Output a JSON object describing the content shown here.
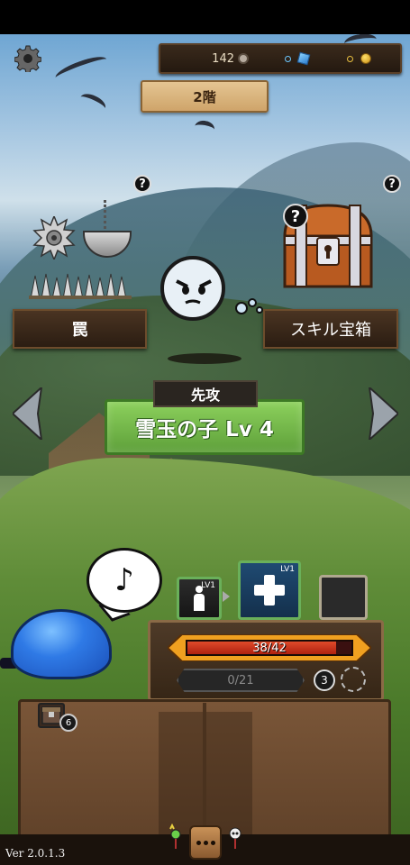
{
  "resources": {
    "medals": "142",
    "gems": "",
    "coins": ""
  },
  "floor": {
    "label": "2階"
  },
  "trap": {
    "label": "罠",
    "help": "?"
  },
  "chest": {
    "label": "スキル宝箱",
    "help": "?",
    "badge": "?"
  },
  "enemy": {
    "first_strike": "先攻",
    "name": "雪玉の子 Lv 4"
  },
  "player": {
    "speech": "♪"
  },
  "skills": {
    "card1_level": "LV1",
    "card2_level": "LV1"
  },
  "status": {
    "hp_text": "38/42",
    "hp_fraction": 0.905,
    "sp_text": "0/21",
    "turn_count": "3"
  },
  "inventory": {
    "item_count": "6"
  },
  "footer": {
    "version": "Ver 2.0.1.3"
  },
  "colors": {
    "enemy_banner": "#5ea03a",
    "hp_bar": "#e04a2a",
    "slime": "#2f7ae6"
  }
}
